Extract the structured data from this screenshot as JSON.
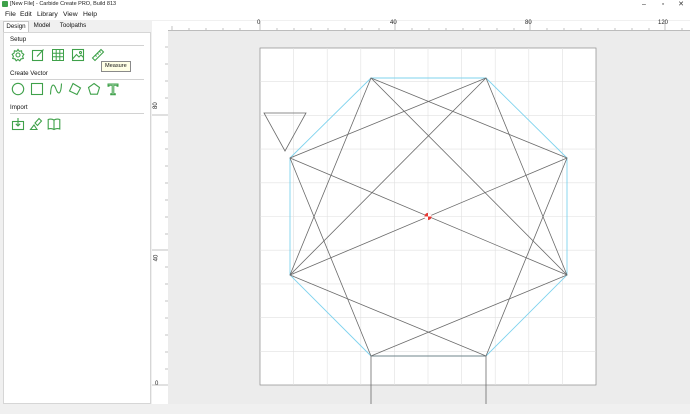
{
  "window": {
    "title": "[New File] - Carbide Create PRO, Build 813",
    "minimize": "–",
    "maximize": "▫",
    "close": "✕"
  },
  "menu": [
    "File",
    "Edit",
    "Library",
    "View",
    "Help"
  ],
  "tabs": [
    "Design",
    "Model",
    "Toolpaths"
  ],
  "sections": {
    "setup": "Setup",
    "create_vector": "Create Vector",
    "import": "Import"
  },
  "tooltip": "Measure",
  "ruler": {
    "horizontal": [
      "0",
      "40",
      "80",
      "120"
    ],
    "vertical": [
      "80",
      "40",
      "0"
    ]
  },
  "icons": {
    "setup": [
      "gear-icon",
      "edit-icon",
      "grid-icon",
      "image-icon",
      "measure-icon"
    ],
    "create_vector": [
      "circle-icon",
      "rectangle-icon",
      "curve-icon",
      "polygon-icon",
      "polygon-pentagon-icon",
      "text-icon"
    ],
    "import": [
      "import-icon",
      "import-vector-icon",
      "library-book-icon"
    ]
  },
  "colors": {
    "icon_green": "#3fa14a",
    "star_line": "#6a6a6a",
    "octagon": "#7fd3ee",
    "origin": "#e53935"
  }
}
